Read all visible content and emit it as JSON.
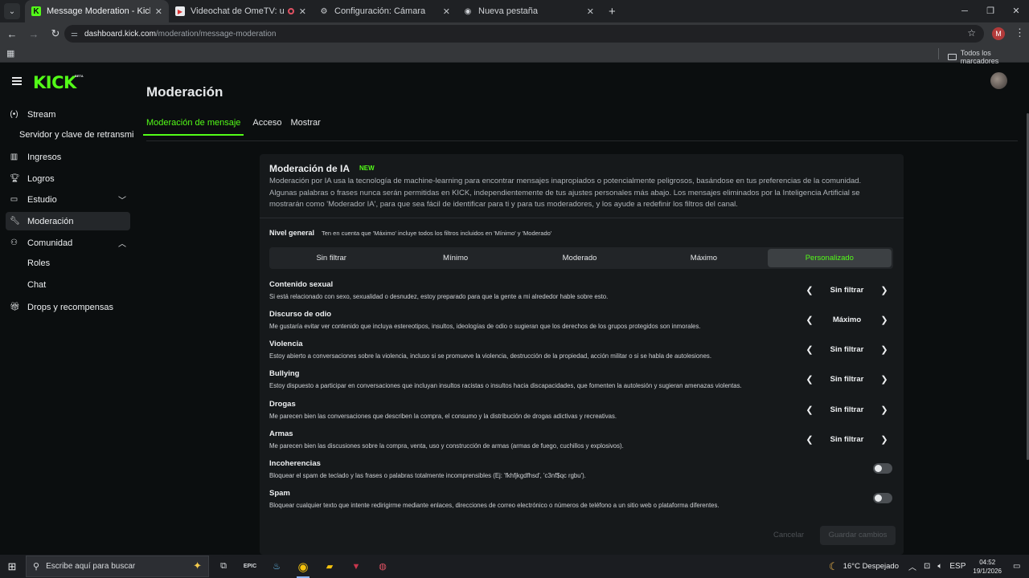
{
  "browser": {
    "tabs": [
      {
        "label": "Message Moderation - Kick Da",
        "icon": "kick-favicon",
        "active": true
      },
      {
        "label": "Videochat de OmeTV: una",
        "icon": "ometv-favicon",
        "active": false
      },
      {
        "label": "Configuración: Cámara",
        "icon": "settings-favicon",
        "active": false
      },
      {
        "label": "Nueva pestaña",
        "icon": "chrome-favicon",
        "active": false
      }
    ],
    "url_host": "dashboard.kick.com",
    "url_path": "/moderation/message-moderation",
    "profile_initial": "M",
    "bookmarks_folder": "Todos los marcadores"
  },
  "kick": {
    "logo": "KICK",
    "logo_badge": "BETA",
    "sidebar": {
      "stream": "Stream",
      "stream_sub": "Servidor y clave de retransmi",
      "ingresos": "Ingresos",
      "logros": "Logros",
      "estudio": "Estudio",
      "moderacion": "Moderación",
      "comunidad": "Comunidad",
      "roles": "Roles",
      "chat": "Chat",
      "drops": "Drops y recompensas"
    },
    "heading": "Moderación",
    "tabs": [
      "Moderación de mensaje",
      "Acceso",
      "Mostrar"
    ],
    "ai": {
      "title": "Moderación de IA",
      "badge": "NEW",
      "description": "Moderación por IA usa la tecnología de machine-learning para encontrar mensajes inapropiados o potencialmente peligrosos, basándose en tus preferencias de la comunidad. Algunas palabras o frases nunca serán permitidas en KICK, independientemente de tus ajustes personales más abajo. Los mensajes eliminados por la Inteligencia Artificial se mostrarán como 'Moderador IA', para que sea fácil de identificar para ti y para tus moderadores, y los ayude a redefinir los filtros del canal."
    },
    "nivel": {
      "label": "Nivel general",
      "note": "Ten en cuenta que 'Máximo' incluye todos los filtros incluidos en 'Mínimo' y 'Moderado'",
      "options": [
        "Sin filtrar",
        "Mínimo",
        "Moderado",
        "Máximo",
        "Personalizado"
      ],
      "selected": "Personalizado"
    },
    "categories": [
      {
        "name": "Contenido sexual",
        "desc": "Si está relacionado con sexo, sexualidad o desnudez, estoy preparado para que la gente a mi alrededor hable sobre esto.",
        "value": "Sin filtrar"
      },
      {
        "name": "Discurso de odio",
        "desc": "Me gustaría evitar ver contenido que incluya estereotipos, insultos, ideologías de odio o sugieran que los derechos de los grupos protegidos son inmorales.",
        "value": "Máximo"
      },
      {
        "name": "Violencia",
        "desc": "Estoy abierto a conversaciones sobre la violencia, incluso si se promueve la violencia, destrucción de la propiedad, acción militar o si se habla de autolesiones.",
        "value": "Sin filtrar"
      },
      {
        "name": "Bullying",
        "desc": "Estoy dispuesto a participar en conversaciones que incluyan insultos racistas o insultos hacia discapacidades, que fomenten la autolesión y sugieran amenazas violentas.",
        "value": "Sin filtrar"
      },
      {
        "name": "Drogas",
        "desc": "Me parecen bien las conversaciones que describen la compra, el consumo y la distribución de drogas adictivas y recreativas.",
        "value": "Sin filtrar"
      },
      {
        "name": "Armas",
        "desc": "Me parecen bien las discusiones sobre la compra, venta, uso y construcción de armas (armas de fuego, cuchillos y explosivos).",
        "value": "Sin filtrar"
      }
    ],
    "toggles": [
      {
        "name": "Incoherencias",
        "desc": "Bloquear el spam de teclado y las frases o palabras totalmente incomprensibles (Ej: 'fkhfjkgdfhsd', 'c3nf$qc rgbu').",
        "on": false
      },
      {
        "name": "Spam",
        "desc": "Bloquear cualquier texto que intente redirigirme mediante enlaces, direcciones de correo electrónico o números de teléfono a un sitio web o plataforma diferentes.",
        "on": false
      }
    ],
    "cancel": "Cancelar",
    "save": "Guardar cambios"
  },
  "taskbar": {
    "search_placeholder": "Escribe aquí para buscar",
    "weather": "16°C  Despejado",
    "lang": "ESP",
    "time": "04:52",
    "date": "19/1/2026"
  },
  "colors": {
    "accent": "#53fc18",
    "background": "#0b0e0f",
    "panel": "#16191b"
  }
}
